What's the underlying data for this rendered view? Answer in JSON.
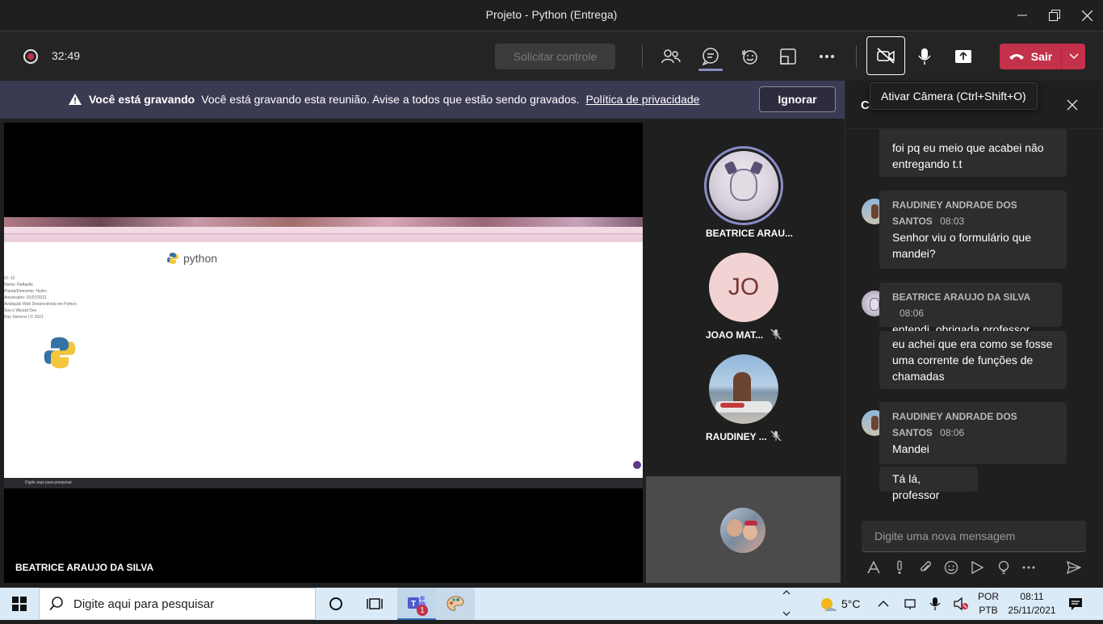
{
  "window": {
    "title": "Projeto - Python (Entrega)"
  },
  "meeting": {
    "timer": "32:49",
    "request_control": "Solicitar controle",
    "leave_label": "Sair",
    "camera_tooltip": "Ativar Câmera (Ctrl+Shift+O)"
  },
  "banner": {
    "bold": "Você está gravando",
    "text": "Você está gravando esta reunião. Avise a todos que estão sendo gravados.",
    "link": "Política de privacidade",
    "ignore": "Ignorar"
  },
  "stage": {
    "presenter": "BEATRICE ARAUJO DA SILVA",
    "shared_python_text": "python",
    "shared_lines": [
      "ID: 12",
      "Nome: Raffaello",
      "Planta/Elemento: Hydro",
      "Aniversário: 01/07/2021",
      "Avaliação Web Desenvolvido em Python",
      "Sou o Wizard Dev",
      "Ray Stevens | © 2021"
    ],
    "shared_search": "Digite aqui para pesquisar"
  },
  "participants": [
    {
      "name": "BEATRICE ARAU...",
      "muted": false,
      "speaking": true
    },
    {
      "name": "JOAO MAT...",
      "initials": "JO",
      "muted": true
    },
    {
      "name": "RAUDINEY ...",
      "muted": true
    }
  ],
  "chat": {
    "header_partial": "C",
    "messages": [
      {
        "text": "foi pq eu meio que acabei não entregando t.t"
      },
      {
        "author": "RAUDINEY ANDRADE DOS SANTOS",
        "time": "08:03",
        "text": "Senhor viu o formulário que mandei?"
      },
      {
        "author": "BEATRICE ARAUJO DA SILVA",
        "time": "08:06",
        "text": "entendi, obrigada professor"
      },
      {
        "text": "eu achei que era como se fosse uma corrente de funções de chamadas"
      },
      {
        "author": "RAUDINEY ANDRADE DOS SANTOS",
        "time": "08:06",
        "text": "Mandei"
      },
      {
        "text": "Tá lá, professor"
      }
    ],
    "compose_placeholder": "Digite uma nova mensagem"
  },
  "taskbar": {
    "search_placeholder": "Digite aqui para pesquisar",
    "teams_badge": "1",
    "weather": "5°C",
    "lang_line1": "POR",
    "lang_line2": "PTB",
    "time": "08:11",
    "date": "25/11/2021"
  }
}
